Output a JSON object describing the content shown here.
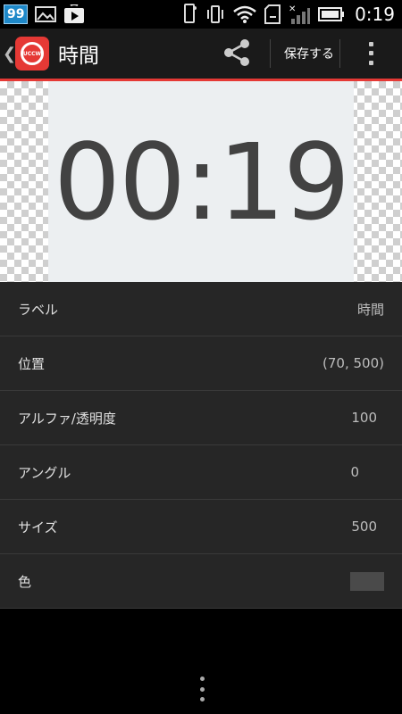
{
  "status_bar": {
    "notification_count": "99",
    "time": "0:19",
    "icons": [
      "gallery-icon",
      "play-store-icon",
      "phone-icon",
      "vibrate-icon",
      "wifi-icon",
      "sdcard-icon",
      "signal-icon",
      "battery-icon"
    ]
  },
  "action_bar": {
    "logo_text": "UCCW",
    "title": "時間",
    "save_label": "保存する",
    "accent_color": "#e53935"
  },
  "preview": {
    "clock_text": "00:19"
  },
  "properties": [
    {
      "label": "ラベル",
      "value": "時間"
    },
    {
      "label": "位置",
      "value": "(70, 500)"
    },
    {
      "label": "アルファ/透明度",
      "value": "100"
    },
    {
      "label": "アングル",
      "value": "0"
    },
    {
      "label": "サイズ",
      "value": "500"
    },
    {
      "label": "色",
      "value": "",
      "swatch": "#4a4a4a"
    }
  ]
}
